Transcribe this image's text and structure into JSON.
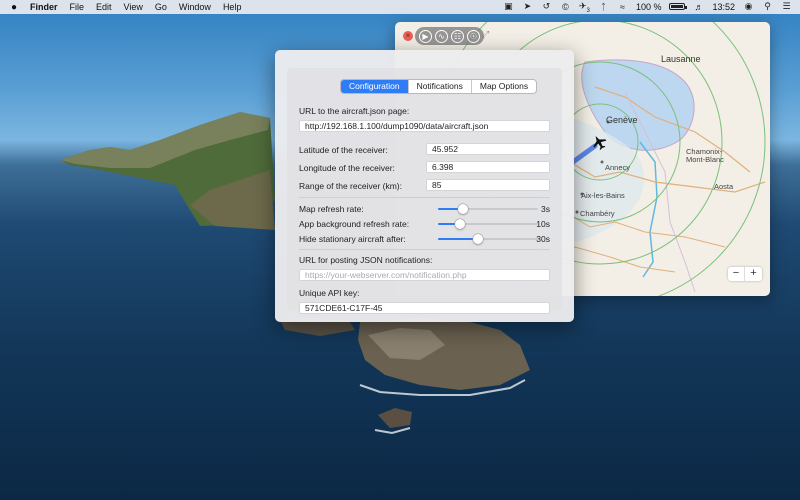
{
  "menubar": {
    "app_name": "Finder",
    "items": [
      "File",
      "Edit",
      "View",
      "Go",
      "Window",
      "Help"
    ],
    "status_icons": [
      "train-icon",
      "rocket-icon",
      "time-machine-icon",
      "copyright-icon",
      "aircraft-icon",
      "bluetooth-icon",
      "wifi-icon",
      "volume-icon"
    ],
    "aircraft_count": "3",
    "battery_percent": "100 %",
    "battery_level": 1.0,
    "clock": "13:52"
  },
  "map": {
    "toolbar_icons": [
      "play-icon",
      "chart-icon",
      "globe-grid-icon",
      "globe-icon"
    ],
    "labels": {
      "lausanne": "Lausanne",
      "geneve": "Genève",
      "annecy": "Annecy",
      "aix": "Aix-les-Bains",
      "chambery": "Chambéry",
      "chamonix": "Chamonix-Mont-Blanc",
      "aosta": "Aosta"
    },
    "zoom_out": "−",
    "zoom_in": "+"
  },
  "prefs": {
    "tabs": [
      {
        "label": "Configuration",
        "active": true
      },
      {
        "label": "Notifications",
        "active": false
      },
      {
        "label": "Map Options",
        "active": false
      }
    ],
    "url_label": "URL to the aircraft.json page:",
    "url_value": "http://192.168.1.100/dump1090/data/aircraft.json",
    "lat_label": "Latitude of the receiver:",
    "lat_value": "45.952",
    "lon_label": "Longitude of the receiver:",
    "lon_value": "6.398",
    "range_label": "Range of the receiver (km):",
    "range_value": "85",
    "sliders": [
      {
        "label": "Map refresh rate:",
        "value": "3s",
        "level": 0.25
      },
      {
        "label": "App background refresh rate:",
        "value": "10s",
        "level": 0.22
      },
      {
        "label": "Hide stationary aircraft after:",
        "value": "30s",
        "level": 0.4
      }
    ],
    "post_label": "URL for posting JSON notifications:",
    "post_placeholder": "https://your-webserver.com/notification.php",
    "api_label": "Unique API key:",
    "api_value": "571CDE61-C17F-45"
  }
}
